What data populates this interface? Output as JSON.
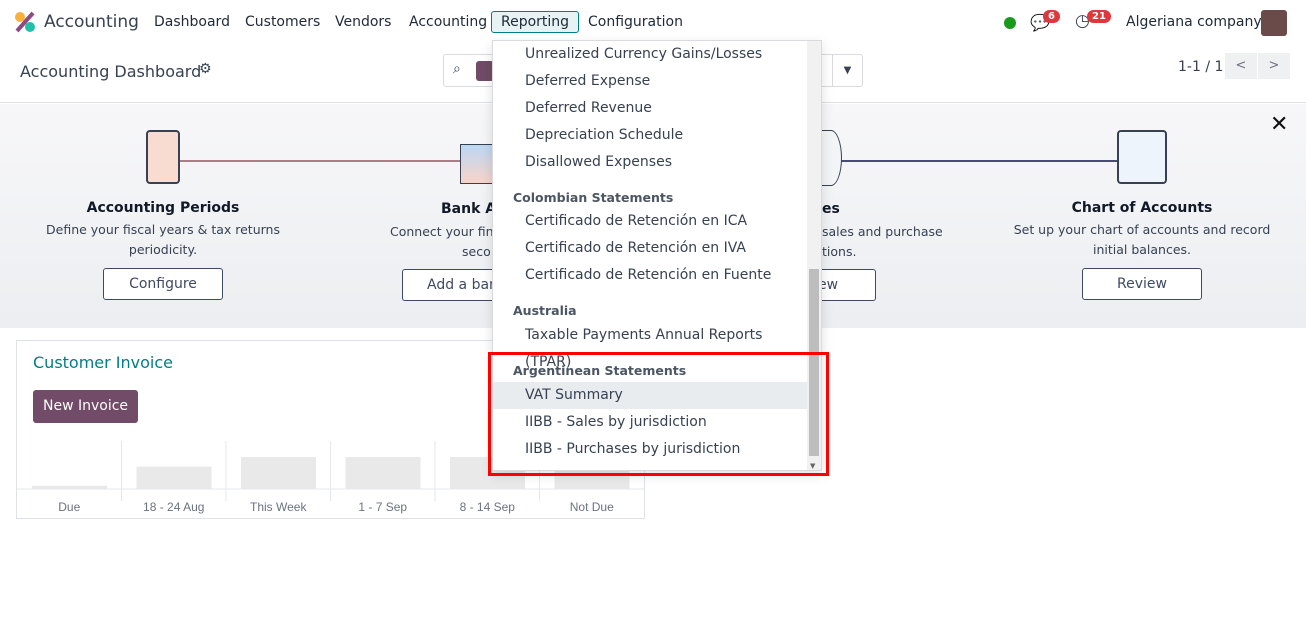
{
  "navbar": {
    "app_name": "Accounting",
    "menus": [
      "Dashboard",
      "Customers",
      "Vendors",
      "Accounting",
      "Reporting",
      "Configuration"
    ],
    "active_menu": "Reporting",
    "messages_count": "6",
    "activities_count": "21",
    "company": "Algeriana company",
    "status_color": "#1a9a1a"
  },
  "control_panel": {
    "title": "Accounting Dashboard",
    "pager": "1-1 / 1"
  },
  "onboarding": {
    "steps": [
      {
        "title": "Accounting Periods",
        "desc1": "Define your fiscal years & tax returns",
        "desc2": "periodicity.",
        "button": "Configure"
      },
      {
        "title": "Bank A",
        "desc1": "Connect your fina",
        "desc2": "seco",
        "button": "Add a ban"
      },
      {
        "title": "es",
        "desc1": "sales and purchase",
        "desc2": "tions.",
        "button": "ew"
      },
      {
        "title": "Chart of Accounts",
        "desc1": "Set up your chart of accounts and record",
        "desc2": "initial balances.",
        "button": "Review"
      }
    ]
  },
  "card": {
    "title": "Customer Invoice",
    "button": "New Invoice"
  },
  "chart_data": {
    "type": "bar",
    "categories": [
      "Due",
      "18 - 24 Aug",
      "This Week",
      "1 - 7 Sep",
      "8 - 14 Sep",
      "Not Due"
    ],
    "values": [
      0.1,
      0.7,
      1,
      1,
      1,
      1
    ],
    "note_placeholder": true
  },
  "dropdown": {
    "items_top": [
      "Unrealized Currency Gains/Losses",
      "Deferred Expense",
      "Deferred Revenue",
      "Depreciation Schedule",
      "Disallowed Expenses"
    ],
    "colombian_header": "Colombian Statements",
    "colombian": [
      "Certificado de Retención en ICA",
      "Certificado de Retención en IVA",
      "Certificado de Retención en Fuente"
    ],
    "australia_header": "Australia",
    "australia": [
      "Taxable Payments Annual Reports (TPAR)"
    ],
    "argentina_header": "Argentinean Statements",
    "argentina": [
      "VAT Summary",
      "IIBB - Sales by jurisdiction",
      "IIBB - Purchases by jurisdiction"
    ],
    "selected": "VAT Summary",
    "scroll_position": 0.55
  },
  "highlight_color": "#ff0000"
}
